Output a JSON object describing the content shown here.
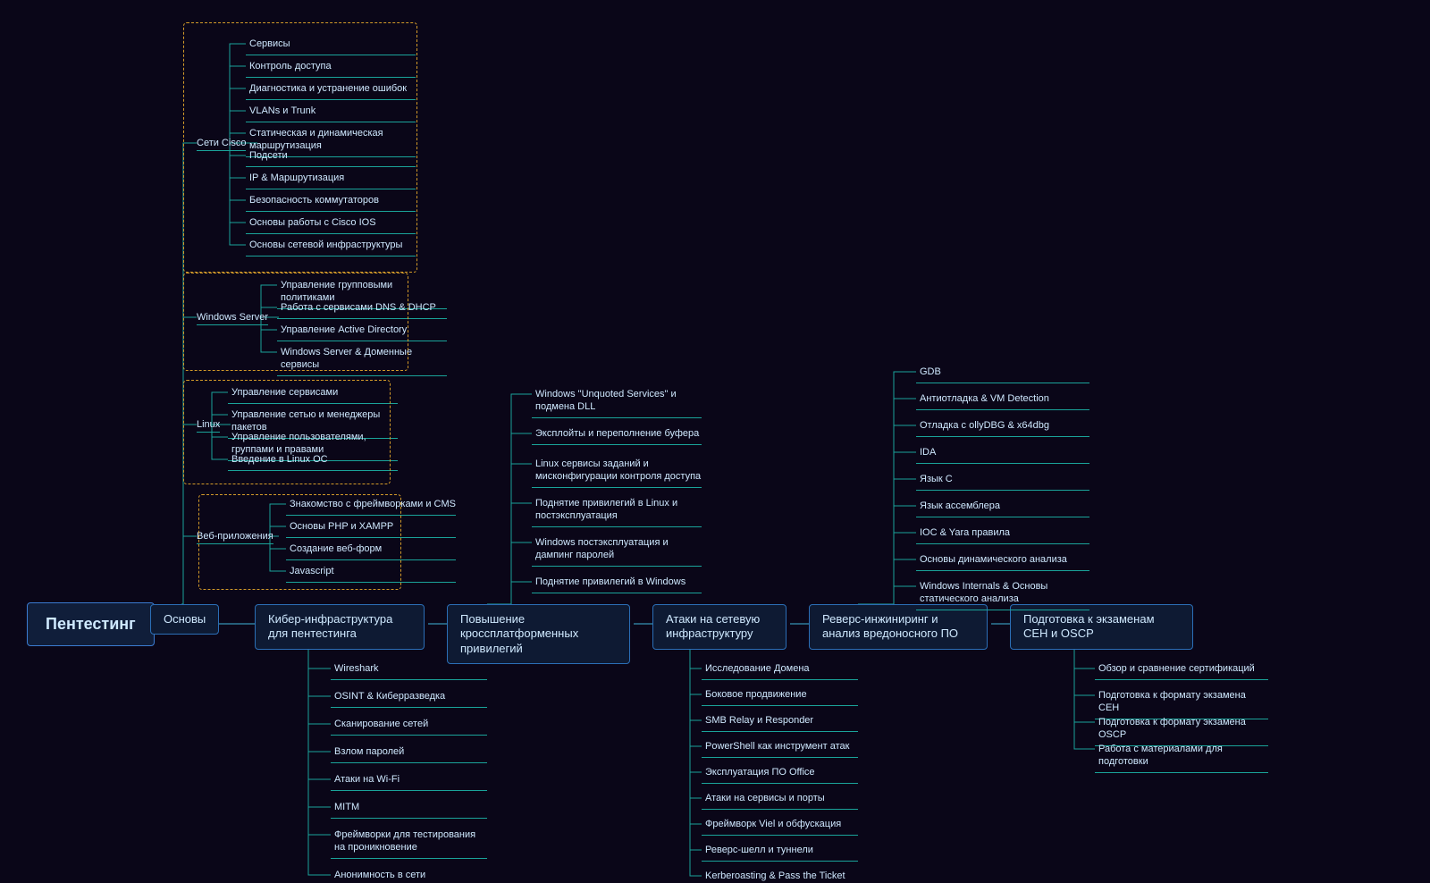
{
  "root": "Пентестинг",
  "main": [
    "Основы",
    "Кибер-инфраструктура для пентестинга",
    "Повышение кроссплатформенных привилегий",
    "Атаки на сетевую инфраструктуру",
    "Реверс-инжиниринг и анализ вредоносного ПО",
    "Подготовка к экзаменам CEH и OSCP"
  ],
  "osnovy_groups": {
    "cisco": {
      "label": "Сети Cisco",
      "items": [
        "Сервисы",
        "Контроль доступа",
        "Диагностика и устранение ошибок",
        "VLANs и Trunk",
        "Статическая и динамическая маршрутизация",
        "Подсети",
        "IP & Маршрутизация",
        "Безопасность коммутаторов",
        "Основы работы с Cisco IOS",
        "Основы сетевой инфраструктуры"
      ]
    },
    "winserver": {
      "label": "Windows Server",
      "items": [
        "Управление групповыми политиками",
        "Работа с сервисами DNS & DHCP",
        "Управление Active Directory",
        "Windows Server & Доменные сервисы"
      ]
    },
    "linux": {
      "label": "Linux",
      "items": [
        "Управление сервисами",
        "Управление сетью и менеджеры пакетов",
        "Управление пользователями, группами и правами",
        "Введение в Linux ОС"
      ]
    },
    "web": {
      "label": "Веб-приложения",
      "items": [
        "Знакомство с фреймворками и CMS",
        "Основы PHP и XAMPP",
        "Создание веб-форм",
        "Javascript"
      ]
    }
  },
  "cyber_items": [
    "Wireshark",
    "OSINT & Киберразведка",
    "Сканирование сетей",
    "Взлом паролей",
    "Атаки на Wi-Fi",
    "MITM",
    "Фреймворки для тестирования на проникновение",
    "Анонимность в сети"
  ],
  "privesc_items": [
    "Windows \"Unquoted Services\" и подмена DLL",
    "Эксплойты и переполнение буфера",
    "Linux сервисы заданий и мисконфигурации контроля доступа",
    "Поднятие привилегий в Linux и постэксплуатация",
    "Windows постэксплуатация и дампинг паролей",
    "Поднятие привилегий в Windows"
  ],
  "netattack_items": [
    "Исследование Домена",
    "Боковое продвижение",
    "SMB Relay и Responder",
    "PowerShell как инструмент атак",
    "Эксплуатация ПО Office",
    "Атаки на сервисы и порты",
    "Фреймворк Viel и обфускация",
    "Реверс-шелл и туннели",
    "Kerberoasting & Pass the Ticket"
  ],
  "reverse_items": [
    "GDB",
    "Антиотладка & VM Detection",
    "Отладка с ollyDBG & x64dbg",
    "IDA",
    "Язык С",
    "Язык ассемблера",
    "IOC & Yara правила",
    "Основы динамического анализа",
    "Windows Internals & Основы статического анализа"
  ],
  "exam_items": [
    "Обзор и сравнение сертификаций",
    "Подготовка к формату экзамена CEH",
    "Подготовка к формату экзамена OSCP",
    "Работа с материалами для подготовки"
  ]
}
